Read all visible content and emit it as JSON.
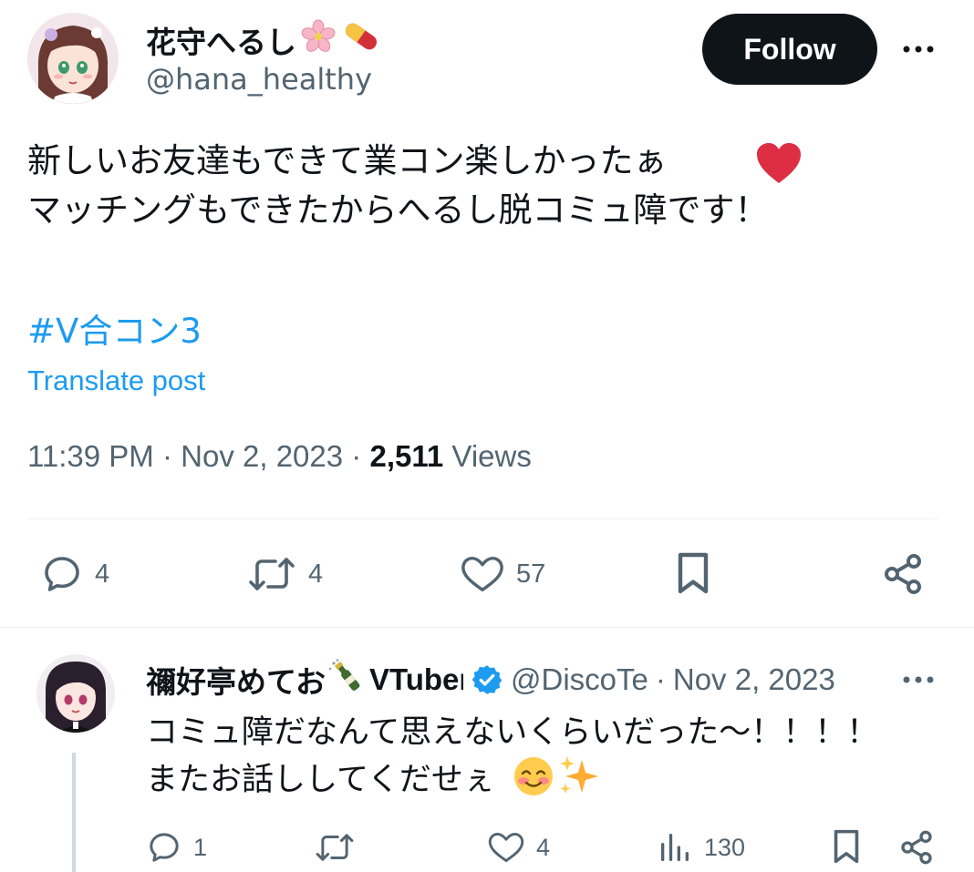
{
  "tweet": {
    "display_name": "花守へるし",
    "name_emojis": [
      "cherry-blossom-icon",
      "pill-icon"
    ],
    "handle": "@hana_healthy",
    "follow_label": "Follow",
    "text": "新しいお友達もできて業コン楽しかったぁ\nマッチングもできたからへるし脱コミュ障です！",
    "hashtag": "#V合コン3",
    "translate_label": "Translate post",
    "time": "11:39 PM",
    "date": "Nov 2, 2023",
    "views_count": "2,511",
    "views_label": "Views",
    "actions": {
      "replies": "4",
      "reposts": "4",
      "likes": "57"
    }
  },
  "reply": {
    "display_name": "禰好亭めてお",
    "name_suffix": "VTuber",
    "verified": true,
    "handle": "@DiscoTe",
    "date": "Nov 2, 2023",
    "text": "コミュ障だなんて思えないくらいだった〜！！！！\nまたお話ししてくだせぇ",
    "actions": {
      "replies": "1",
      "reposts": "",
      "likes": "4",
      "views": "130"
    }
  },
  "colors": {
    "accent": "#1d9bf0",
    "text": "#0f1419",
    "secondary": "#536471",
    "heart": "#f4212e",
    "divider": "#eff3f4"
  }
}
